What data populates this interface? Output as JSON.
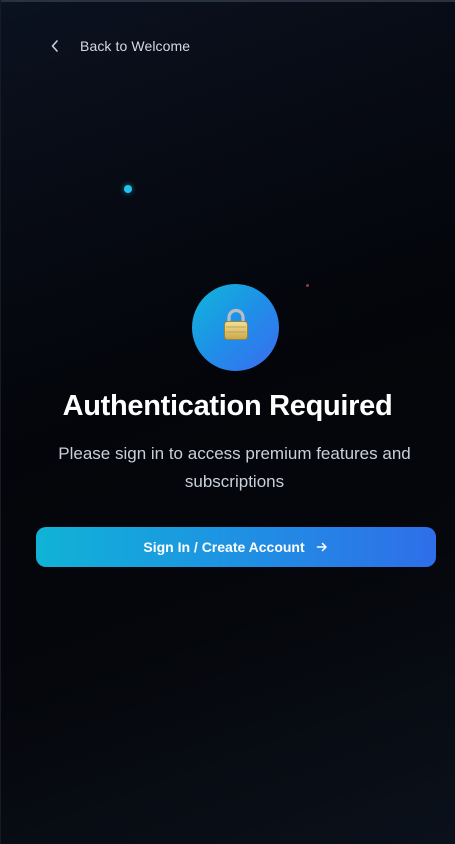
{
  "nav": {
    "back_label": "Back to Welcome",
    "back_icon": "chevron-left-icon"
  },
  "hero": {
    "icon": "lock-icon",
    "title": "Authentication Required",
    "subtitle": "Please sign in to access premium features and subscriptions"
  },
  "cta": {
    "label": "Sign In / Create Account",
    "icon": "arrow-right-icon"
  },
  "colors": {
    "accent_start": "#10b3d6",
    "accent_end": "#2f6ee9",
    "background": "#05070d",
    "text_primary": "#ffffff",
    "text_secondary": "#c9d0da"
  }
}
